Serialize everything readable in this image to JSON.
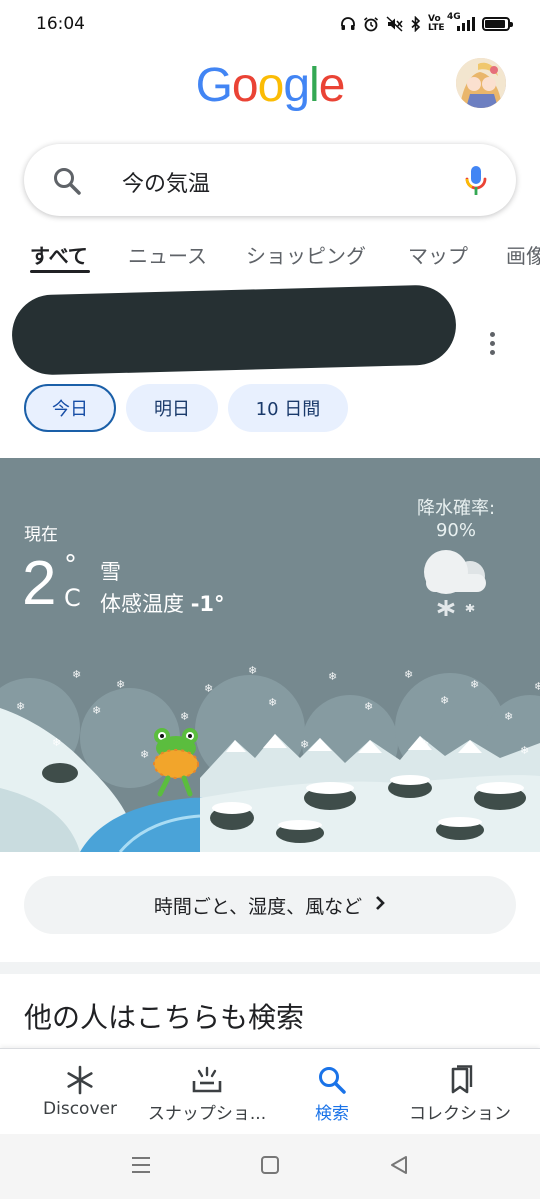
{
  "status_bar": {
    "time": "16:04",
    "icons": [
      "headphones-icon",
      "alarm-icon",
      "mute-icon",
      "bluetooth-icon",
      "volte-icon",
      "signal-4g-icon",
      "battery-icon"
    ],
    "volte": "Vo LTE",
    "network": "4G",
    "battery_level": 0.9
  },
  "header": {
    "logo_letters": [
      "G",
      "o",
      "o",
      "g",
      "l",
      "e"
    ],
    "logo_colors": [
      "#4285f4",
      "#ea4335",
      "#fbbc05",
      "#4285f4",
      "#34a853",
      "#ea4335"
    ]
  },
  "search": {
    "query": "今の気温"
  },
  "tabs": [
    {
      "label": "すべて",
      "active": true
    },
    {
      "label": "ニュース"
    },
    {
      "label": "ショッピング"
    },
    {
      "label": "マップ"
    },
    {
      "label": "画像"
    }
  ],
  "day_chips": [
    {
      "label": "今日",
      "active": true
    },
    {
      "label": "明日"
    },
    {
      "label": "10 日間"
    }
  ],
  "weather": {
    "now_label": "現在",
    "temperature": "2",
    "unit_symbol": "°",
    "unit_letter": "C",
    "condition": "雪",
    "feels_like_label": "体感温度",
    "feels_like_value": "-1°",
    "precip_label": "降水確率:",
    "precip_value": "90%",
    "background_color": "#76898f"
  },
  "details_button": {
    "label": "時間ごと、湿度、風など",
    "chevron": "›"
  },
  "related": {
    "title": "他の人はこちらも検索"
  },
  "bottom_nav": [
    {
      "label": "Discover",
      "icon": "asterisk-icon"
    },
    {
      "label": "スナップショ...",
      "icon": "snapshot-icon"
    },
    {
      "label": "検索",
      "icon": "search-icon",
      "active": true
    },
    {
      "label": "コレクション",
      "icon": "collections-icon"
    }
  ],
  "system_nav": [
    "menu-icon",
    "home-icon",
    "back-icon"
  ]
}
